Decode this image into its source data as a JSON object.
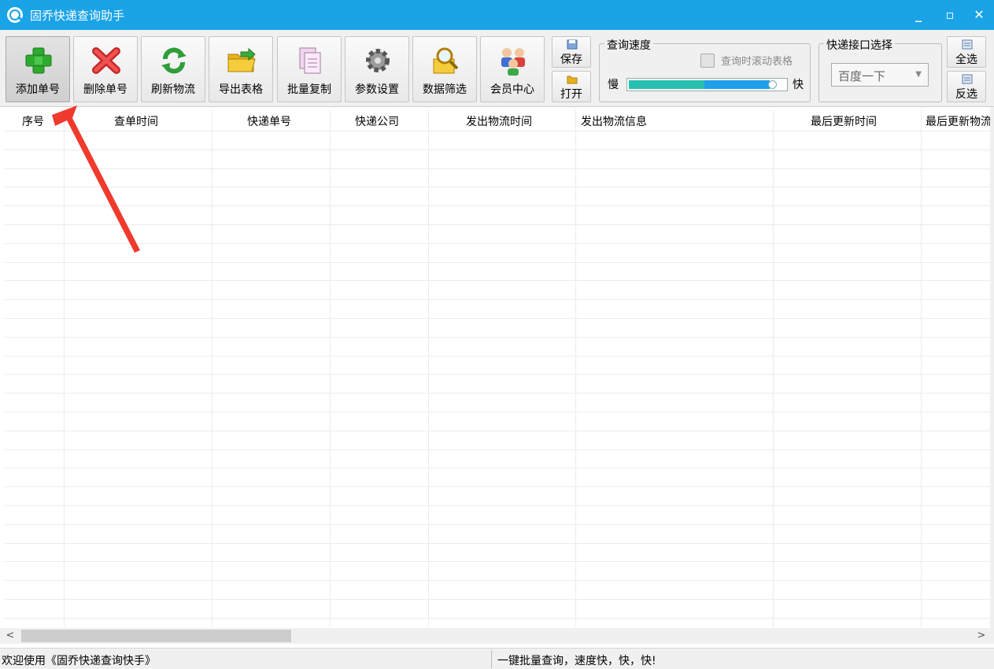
{
  "window": {
    "title": "固乔快递查询助手",
    "minimize_icon": "minimize-icon",
    "maximize_icon": "maximize-icon",
    "close_icon": "close-icon"
  },
  "toolbar": {
    "buttons": [
      {
        "label": "添加单号",
        "icon": "plus-icon",
        "active": true
      },
      {
        "label": "删除单号",
        "icon": "delete-x-icon"
      },
      {
        "label": "刷新物流",
        "icon": "refresh-icon"
      },
      {
        "label": "导出表格",
        "icon": "folder-export-icon"
      },
      {
        "label": "批量复制",
        "icon": "copy-documents-icon"
      },
      {
        "label": "参数设置",
        "icon": "gear-icon"
      },
      {
        "label": "数据筛选",
        "icon": "magnifier-filter-icon"
      },
      {
        "label": "会员中心",
        "icon": "members-icon"
      }
    ],
    "save_label": "保存",
    "open_label": "打开",
    "speed_group": {
      "title": "查询速度",
      "checkbox_label": "查询时滚动表格",
      "checkbox_checked": false,
      "slow_label": "慢",
      "fast_label": "快",
      "speed_value": 0.92
    },
    "api_group": {
      "title": "快递接口选择",
      "selected": "百度一下"
    },
    "select_all_label": "全选",
    "invert_label": "反选"
  },
  "table": {
    "columns": [
      "序号",
      "查单时间",
      "快递单号",
      "快递公司",
      "发出物流时间",
      "发出物流信息",
      "最后更新时间",
      "最后更新物流"
    ],
    "rows": []
  },
  "statusbar": {
    "left": "欢迎使用《固乔快递查询快手》",
    "right": "一键批量查询，速度快，快，快!"
  },
  "colors": {
    "titlebar": "#1aa3e6",
    "annotation_arrow": "#f03a2e",
    "speed_fill_slow": "#27c0b0",
    "speed_fill_fast": "#1e9fe9"
  }
}
